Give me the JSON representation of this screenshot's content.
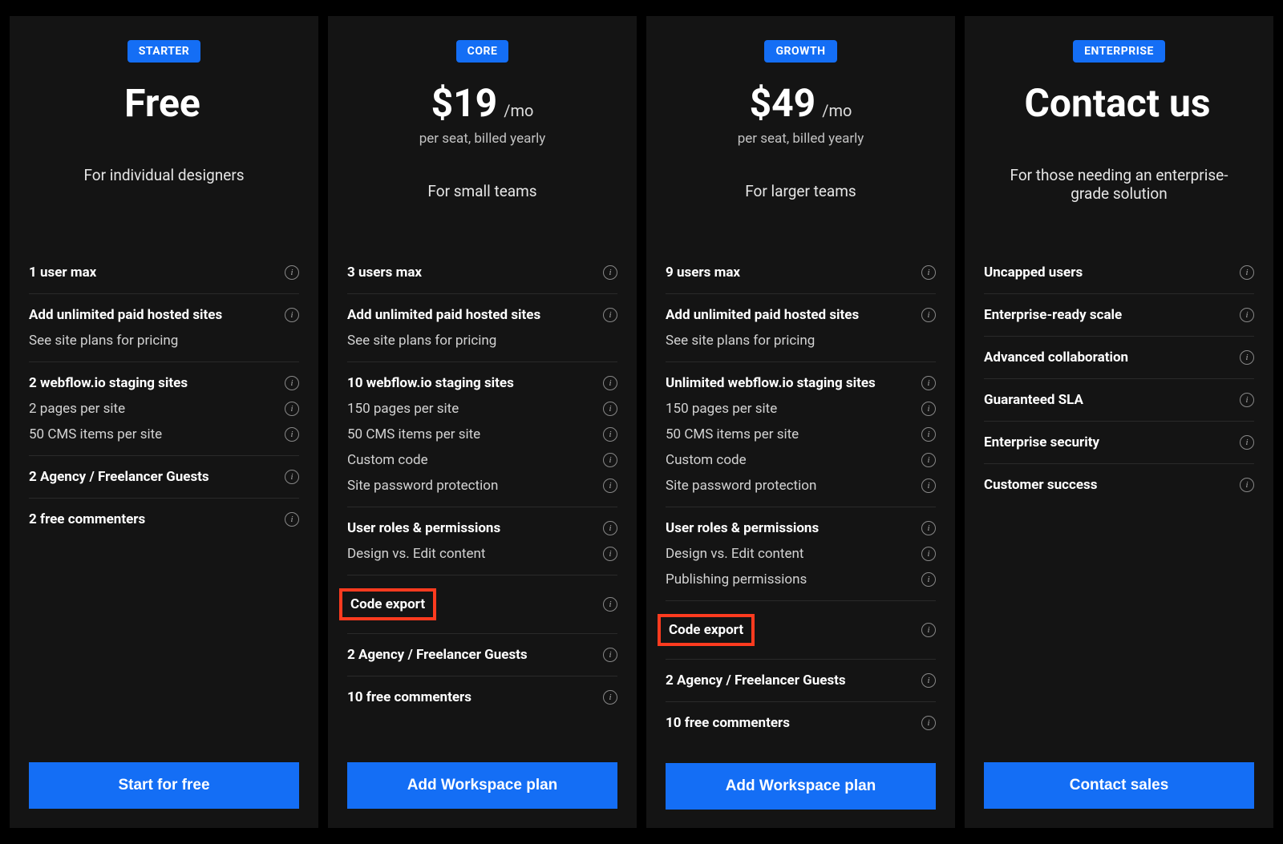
{
  "plans": [
    {
      "badge": "STARTER",
      "price": "Free",
      "price_suffix": "",
      "billing": "",
      "subtitle": "For individual designers",
      "cta": "Start for free",
      "feature_groups": [
        [
          {
            "label": "1 user max",
            "bold": true,
            "info": true
          }
        ],
        [
          {
            "label": "Add unlimited paid hosted sites",
            "bold": true,
            "info": true
          },
          {
            "label": "See site plans for pricing",
            "bold": false,
            "info": false
          }
        ],
        [
          {
            "label": "2 webflow.io staging sites",
            "bold": true,
            "info": true
          },
          {
            "label": "2 pages per site",
            "bold": false,
            "info": true
          },
          {
            "label": "50 CMS items per site",
            "bold": false,
            "info": true
          }
        ],
        [
          {
            "label": "2 Agency / Freelancer Guests",
            "bold": true,
            "info": true
          }
        ],
        [
          {
            "label": "2 free commenters",
            "bold": true,
            "info": true
          }
        ]
      ]
    },
    {
      "badge": "CORE",
      "price": "$19",
      "price_suffix": "/mo",
      "billing": "per seat, billed yearly",
      "subtitle": "For small teams",
      "cta": "Add Workspace plan",
      "feature_groups": [
        [
          {
            "label": "3 users max",
            "bold": true,
            "info": true
          }
        ],
        [
          {
            "label": "Add unlimited paid hosted sites",
            "bold": true,
            "info": true
          },
          {
            "label": "See site plans for pricing",
            "bold": false,
            "info": false
          }
        ],
        [
          {
            "label": "10 webflow.io staging sites",
            "bold": true,
            "info": true
          },
          {
            "label": "150 pages per site",
            "bold": false,
            "info": true
          },
          {
            "label": "50 CMS items per site",
            "bold": false,
            "info": true
          },
          {
            "label": "Custom code",
            "bold": false,
            "info": true
          },
          {
            "label": "Site password protection",
            "bold": false,
            "info": true
          }
        ],
        [
          {
            "label": "User roles & permissions",
            "bold": true,
            "info": true
          },
          {
            "label": "Design vs. Edit content",
            "bold": false,
            "info": true
          }
        ],
        [
          {
            "label": "Code export",
            "bold": true,
            "info": true,
            "highlight": true
          }
        ],
        [
          {
            "label": "2 Agency / Freelancer Guests",
            "bold": true,
            "info": true
          }
        ],
        [
          {
            "label": "10 free commenters",
            "bold": true,
            "info": true
          }
        ]
      ]
    },
    {
      "badge": "GROWTH",
      "price": "$49",
      "price_suffix": "/mo",
      "billing": "per seat, billed yearly",
      "subtitle": "For larger teams",
      "cta": "Add Workspace plan",
      "feature_groups": [
        [
          {
            "label": "9 users max",
            "bold": true,
            "info": true
          }
        ],
        [
          {
            "label": "Add unlimited paid hosted sites",
            "bold": true,
            "info": true
          },
          {
            "label": "See site plans for pricing",
            "bold": false,
            "info": false
          }
        ],
        [
          {
            "label": "Unlimited webflow.io staging sites",
            "bold": true,
            "info": true
          },
          {
            "label": "150 pages per site",
            "bold": false,
            "info": true
          },
          {
            "label": "50 CMS items per site",
            "bold": false,
            "info": true
          },
          {
            "label": "Custom code",
            "bold": false,
            "info": true
          },
          {
            "label": "Site password protection",
            "bold": false,
            "info": true
          }
        ],
        [
          {
            "label": "User roles & permissions",
            "bold": true,
            "info": true
          },
          {
            "label": "Design vs. Edit content",
            "bold": false,
            "info": true
          },
          {
            "label": "Publishing permissions",
            "bold": false,
            "info": true
          }
        ],
        [
          {
            "label": "Code export",
            "bold": true,
            "info": true,
            "highlight": true
          }
        ],
        [
          {
            "label": "2 Agency / Freelancer Guests",
            "bold": true,
            "info": true
          }
        ],
        [
          {
            "label": "10 free commenters",
            "bold": true,
            "info": true
          }
        ]
      ]
    },
    {
      "badge": "ENTERPRISE",
      "price": "Contact us",
      "price_suffix": "",
      "billing": "",
      "subtitle": "For those needing  an enterprise-grade solution",
      "cta": "Contact sales",
      "feature_groups": [
        [
          {
            "label": "Uncapped users",
            "bold": true,
            "info": true
          }
        ],
        [
          {
            "label": "Enterprise-ready scale",
            "bold": true,
            "info": true
          }
        ],
        [
          {
            "label": "Advanced collaboration",
            "bold": true,
            "info": true
          }
        ],
        [
          {
            "label": "Guaranteed SLA",
            "bold": true,
            "info": true
          }
        ],
        [
          {
            "label": "Enterprise security",
            "bold": true,
            "info": true
          }
        ],
        [
          {
            "label": "Customer success",
            "bold": true,
            "info": true
          }
        ]
      ]
    }
  ]
}
